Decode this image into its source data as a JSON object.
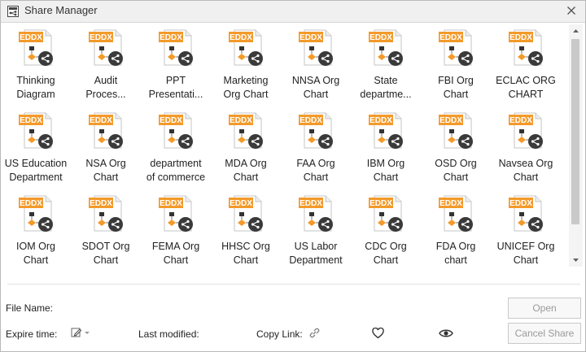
{
  "window": {
    "title": "Share Manager"
  },
  "icons": {
    "app": "share-manager-app-icon",
    "close": "close-icon",
    "file": "eddx-share-file-icon",
    "edit": "edit-pencil-icon",
    "link": "link-icon",
    "favorite": "heart-icon",
    "preview": "eye-icon"
  },
  "colors": {
    "eddx_badge": "#f39a2a",
    "share_badge": "#3a3a3a",
    "button_text_disabled": "#9a9a9a"
  },
  "file_badge": "EDDX",
  "files": [
    {
      "label": "Thinking\nDiagram"
    },
    {
      "label": "Audit\nProces..."
    },
    {
      "label": "PPT\nPresentati..."
    },
    {
      "label": "Marketing\nOrg Chart"
    },
    {
      "label": "NNSA Org\nChart"
    },
    {
      "label": "State\ndepartme..."
    },
    {
      "label": "FBI Org\nChart"
    },
    {
      "label": "ECLAC ORG\nCHART"
    },
    {
      "label": "US Education\nDepartment"
    },
    {
      "label": "NSA Org\nChart"
    },
    {
      "label": "department\nof commerce"
    },
    {
      "label": "MDA Org\nChart"
    },
    {
      "label": "FAA Org\nChart"
    },
    {
      "label": "IBM Org\nChart"
    },
    {
      "label": "OSD Org\nChart"
    },
    {
      "label": "Navsea Org\nChart"
    },
    {
      "label": "IOM Org\nChart"
    },
    {
      "label": "SDOT Org\nChart"
    },
    {
      "label": "FEMA Org\nChart"
    },
    {
      "label": "HHSC Org\nChart"
    },
    {
      "label": "US Labor\nDepartment"
    },
    {
      "label": "CDC Org\nChart"
    },
    {
      "label": "FDA Org\nchart"
    },
    {
      "label": "UNICEF Org\nChart"
    }
  ],
  "footer": {
    "file_name_label": "File Name:",
    "expire_time_label": "Expire time:",
    "last_modified_label": "Last modified:",
    "copy_link_label": "Copy Link:",
    "open_button": "Open",
    "cancel_share_button": "Cancel Share"
  }
}
